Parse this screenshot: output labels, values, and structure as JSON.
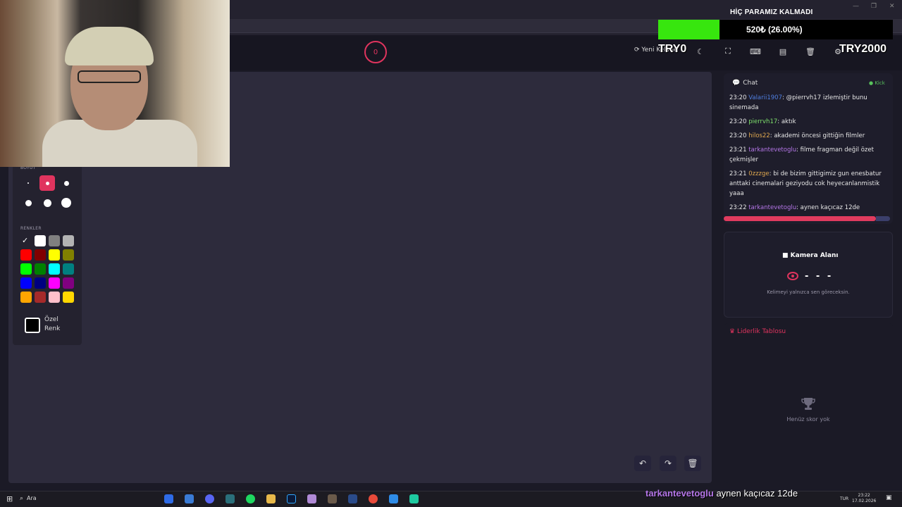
{
  "overlay": {
    "title": "HİÇ PARAMIZ KALMADI",
    "amount": "520₺ (26.00%)",
    "progress": 0.26,
    "left_goal": "TRY0",
    "right_goal": "TRY2000",
    "ticker_user": "tarkantevetoglu",
    "ticker_text": "aynen kaçıcaz 12de"
  },
  "appbar": {
    "timer_value": "0",
    "new_word_label": "Yeni Kelime",
    "icons": [
      "refresh-icon",
      "moon-icon",
      "fullscreen-icon",
      "keyboard-icon",
      "archive-icon",
      "trash-icon",
      "gear-icon"
    ]
  },
  "toolpanel": {
    "size_label": "BOYUT",
    "colors_label": "RENKLER",
    "custom_label_1": "Özel",
    "custom_label_2": "Renk",
    "swatches": [
      "#ffffff",
      "#ffffff",
      "#808080",
      "#b3b3b3",
      "#ff0000",
      "#800000",
      "#ffff00",
      "#808000",
      "#00ff00",
      "#008000",
      "#00ffff",
      "#008080",
      "#0000ff",
      "#000080",
      "#ff00ff",
      "#800080",
      "#ffa500",
      "#a52a2a",
      "#ffc0cb",
      "#ffd700"
    ],
    "accent": "#e0345e"
  },
  "chat": {
    "title": "Chat",
    "platform": "Kick",
    "messages": [
      {
        "time": "23:20",
        "user": "Valarii1907",
        "user_color": "#4f7fe0",
        "text": ": @pierrvh17 izlemiştir bunu sinemada"
      },
      {
        "time": "23:20",
        "user": "pierrvh17",
        "user_color": "#7de06b",
        "text": ": aktık"
      },
      {
        "time": "23:20",
        "user": "hilos22",
        "user_color": "#e0a84f",
        "text": ": akademi öncesi gittiğin filmler"
      },
      {
        "time": "23:21",
        "user": "tarkantevetoglu",
        "user_color": "#b576e8",
        "text": ": filme fragman değil özet çekmişler"
      },
      {
        "time": "23:21",
        "user": "0zzzge",
        "user_color": "#e0a84f",
        "text": ": bi de bizim gittigimiz gun enesbatur anttaki cinemalari geziyodu cok heyecanlanmistik yaaa"
      },
      {
        "time": "23:22",
        "user": "tarkantevetoglu",
        "user_color": "#b576e8",
        "text": ": aynen kaçıcaz 12de"
      }
    ]
  },
  "camera": {
    "title": "Kamera Alanı",
    "word": "- - -",
    "hint": "Kelimeyi yalnızca sen göreceksin."
  },
  "leaderboard": {
    "title": "Liderlik Tablosu",
    "empty": "Henüz skor yok"
  },
  "taskbar": {
    "search": "Ara",
    "lang": "TUR",
    "time": "23:22",
    "date": "17.02.2026"
  }
}
